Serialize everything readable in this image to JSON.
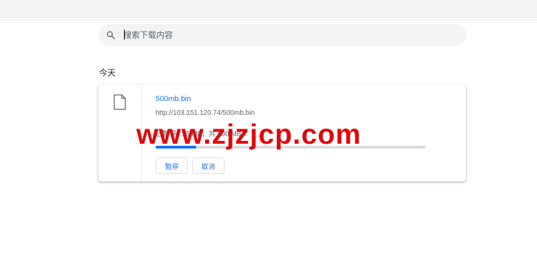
{
  "search": {
    "placeholder": "搜索下载内容"
  },
  "section": {
    "title": "今天"
  },
  "download": {
    "filename": "500mb.bin",
    "url": "http://103.151.120.74/500mb.bin",
    "status": "已暂停 ... 5 MB，共 500 MB",
    "progress_fraction": 0.15,
    "pause_label": "暂停",
    "cancel_label": "取消"
  },
  "watermark": {
    "text": "www.zjzjcp.com"
  },
  "colors": {
    "accent": "#1a73e8",
    "watermark": "#e0080b",
    "search_bg": "#f1f3f4"
  }
}
